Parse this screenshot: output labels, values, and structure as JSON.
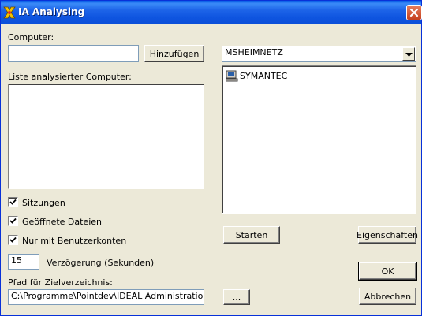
{
  "window": {
    "title": "IA Analysing",
    "accent": "#0a5ee6",
    "close_color": "#c5401e"
  },
  "computer": {
    "label": "Computer:",
    "value": "",
    "add_button": "Hinzufügen"
  },
  "analyzed_list": {
    "label": "Liste analysierter Computer:",
    "items": []
  },
  "options": {
    "sessions": {
      "label": "Sitzungen",
      "checked": true
    },
    "open_files": {
      "label": "Geöffnete Dateien",
      "checked": true
    },
    "user_accounts_only": {
      "label": "Nur mit Benutzerkonten",
      "checked": true
    }
  },
  "delay": {
    "value": "15",
    "label": "Verzögerung (Sekunden)"
  },
  "target_path": {
    "label": "Pfad für Zielverzeichnis:",
    "value": "C:\\Programme\\Pointdev\\IDEAL Administration\\Ser",
    "browse_button": "..."
  },
  "network": {
    "selected": "MSHEIMNETZ",
    "computers": [
      {
        "name": "SYMANTEC",
        "icon": "computer-icon"
      }
    ]
  },
  "buttons": {
    "start": "Starten",
    "properties": "Eigenschaften",
    "ok": "OK",
    "cancel": "Abbrechen"
  }
}
